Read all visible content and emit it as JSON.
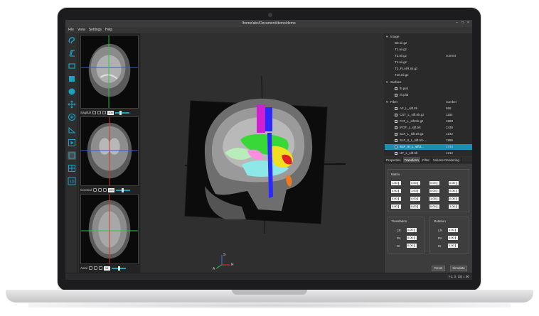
{
  "window": {
    "title": "/home/abc/Document/demo/demo"
  },
  "menu": [
    "File",
    "View",
    "Settings",
    "Help"
  ],
  "toolbar_icons": [
    "lasso-icon",
    "freehand-icon",
    "rectangle-outline-icon",
    "rectangle-filled-icon",
    "circle-icon",
    "move-icon",
    "add-point-icon",
    "angle-icon",
    "play-icon",
    "grid-single-icon",
    "grid-quad-icon",
    "3d-icon"
  ],
  "views": {
    "sagittal": {
      "label": "Sagittal",
      "value": "100"
    },
    "coronal": {
      "label": "Coronal",
      "value": "100"
    },
    "axial": {
      "label": "Axial",
      "value": "94"
    }
  },
  "axis_labels": {
    "s": "S",
    "a": "A",
    "r": "R"
  },
  "tree": {
    "image_header": "Image",
    "images": [
      {
        "name": "B0.nii.gz",
        "value": ""
      },
      {
        "name": "T1.nii.gz",
        "value": ""
      },
      {
        "name": "T2.nii.gz",
        "value": "current"
      },
      {
        "name": "T1.nii.gz",
        "value": ""
      },
      {
        "name": "T2_FLAIR.nii.gz",
        "value": ""
      },
      {
        "name": "T10.nii.gz",
        "value": ""
      }
    ],
    "surface_header": "Surface",
    "surfaces": [
      "lh.pial",
      "rh.pial"
    ],
    "fiber_header": "Fiber",
    "fiber_col": "number",
    "fibers": [
      {
        "name": "AF_L_sift.trk",
        "value": "958"
      },
      {
        "name": "CST_L_sift.trk.gz",
        "value": "1184"
      },
      {
        "name": "FAT_L_sift.trk.gz",
        "value": "1880"
      },
      {
        "name": "IFOF_L_sift.trk",
        "value": "2430"
      },
      {
        "name": "SLF_L_sift.trk.gz",
        "value": "1242"
      },
      {
        "name": "SLF_II_L_sift.trk-...",
        "value": "1986"
      },
      {
        "name": "SLF_III_L_sift.t...",
        "value": "1744"
      },
      {
        "name": "UF_L_sift.trk",
        "value": "1212"
      }
    ]
  },
  "tabs": [
    "Properties",
    "Transform",
    "Filter",
    "Volume Rendering"
  ],
  "active_tab": "Transform",
  "matrix": {
    "label": "Matrix",
    "values": [
      [
        "1.00",
        "0.00",
        "0.00",
        "0.00"
      ],
      [
        "0.00",
        "1.00",
        "0.00",
        "0.00"
      ],
      [
        "0.00",
        "0.00",
        "1.00",
        "0.00"
      ],
      [
        "0.00",
        "0.00",
        "0.00",
        "1.00"
      ]
    ]
  },
  "translation": {
    "label": "Translation",
    "rows": [
      {
        "axis": "LR",
        "value": "0.00"
      },
      {
        "axis": "PA",
        "value": "0.00"
      },
      {
        "axis": "IS",
        "value": "0.00"
      }
    ]
  },
  "rotation": {
    "label": "Rotation",
    "rows": [
      {
        "axis": "LR",
        "value": "0.00"
      },
      {
        "axis": "PA",
        "value": "0.00"
      },
      {
        "axis": "IS",
        "value": "0.00"
      }
    ]
  },
  "buttons": {
    "reset": "Reset",
    "simulate": "Simulate"
  },
  "status": "[-1, 0, 15] = 90",
  "colors": {
    "accent": "#1ba1c4",
    "selection": "#1b8fb0",
    "background": "#2b2b2b"
  }
}
